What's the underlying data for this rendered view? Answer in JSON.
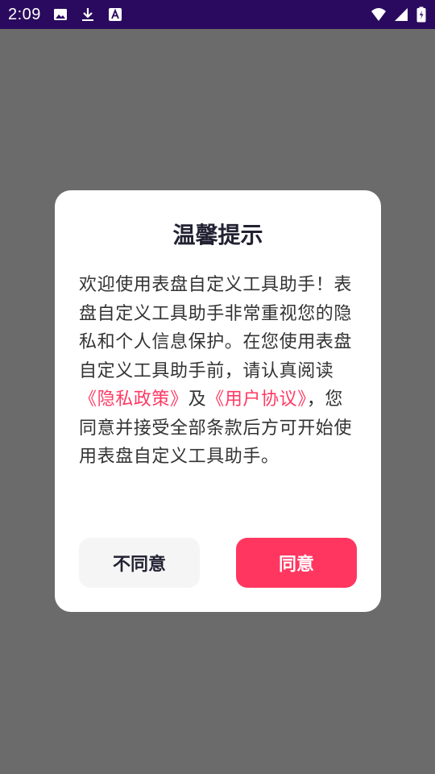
{
  "status_bar": {
    "time": "2:09",
    "left_icons": [
      "image-icon",
      "download-icon",
      "font-icon"
    ],
    "right_icons": [
      "wifi-icon",
      "signal-icon",
      "battery-icon"
    ]
  },
  "dialog": {
    "title": "温馨提示",
    "body": {
      "p1": "欢迎使用表盘自定义工具助手！表盘自定义工具助手非常重视您的隐私和个人信息保护。在您使用表盘自定义工具助手前，请认真阅读",
      "privacy_link": "《隐私政策》",
      "and": "及",
      "user_link": "《用户协议》",
      "p2": "，您同意并接受全部条款后方可开始使用表盘自定义工具助手。"
    },
    "disagree_label": "不同意",
    "agree_label": "同意"
  },
  "colors": {
    "status_bar": "#2a0a5e",
    "scrim": "#6b6b6b",
    "accent": "#ff3760",
    "link": "#ff3a64"
  }
}
